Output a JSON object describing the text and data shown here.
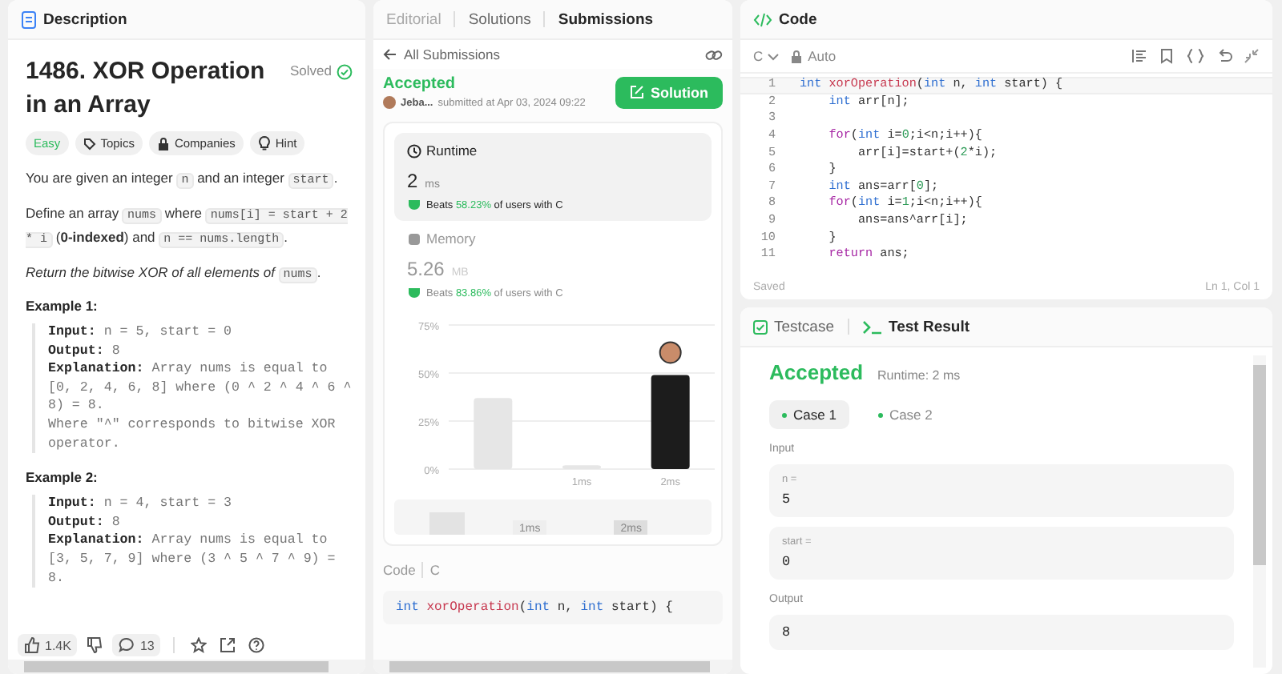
{
  "description_panel": {
    "tab": "Description",
    "title": "1486. XOR Operation in an Array",
    "status": "Solved",
    "tags": [
      {
        "kind": "difficulty",
        "label": "Easy",
        "color": "#2cbb5d"
      },
      {
        "kind": "topics",
        "label": "Topics"
      },
      {
        "kind": "companies",
        "label": "Companies"
      },
      {
        "kind": "hint",
        "label": "Hint"
      }
    ],
    "paragraphs": [
      [
        {
          "kind": "text",
          "text": "You are given an integer "
        },
        {
          "kind": "code",
          "text": "n"
        },
        {
          "kind": "text",
          "text": " and an integer "
        },
        {
          "kind": "code",
          "text": "start"
        },
        {
          "kind": "text",
          "text": "."
        }
      ],
      [
        {
          "kind": "text",
          "text": "Define an array "
        },
        {
          "kind": "code",
          "text": "nums"
        },
        {
          "kind": "text",
          "text": " where "
        },
        {
          "kind": "code",
          "text": "nums[i] = start + 2 * i"
        },
        {
          "kind": "text",
          "text": " ("
        },
        {
          "kind": "bold",
          "text": "0-indexed"
        },
        {
          "kind": "text",
          "text": ") and "
        },
        {
          "kind": "code",
          "text": "n == nums.length"
        },
        {
          "kind": "text",
          "text": "."
        }
      ],
      [
        {
          "kind": "italic",
          "text": "Return the bitwise XOR of all elements of "
        },
        {
          "kind": "code",
          "text": "nums"
        },
        {
          "kind": "text",
          "text": "."
        }
      ]
    ],
    "examples": [
      {
        "title": "Example 1:",
        "input_label": "Input:",
        "output_label": "Output:",
        "explanation_label": "Explanation:",
        "input": "n = 5, start = 0",
        "output": "8",
        "explanation": "Array nums is equal to [0, 2, 4, 6, 8] where (0 ^ 2 ^ 4 ^ 6 ^ 8) = 8.\nWhere \"^\" corresponds to bitwise XOR operator."
      },
      {
        "title": "Example 2:",
        "input_label": "Input:",
        "output_label": "Output:",
        "explanation_label": "Explanation:",
        "input": "n = 4, start = 3",
        "output": "8",
        "explanation": "Array nums is equal to [3, 5, 7, 9] where (3 ^ 5 ^ 7 ^ 9) = 8."
      }
    ],
    "footer": {
      "likes": "1.4K",
      "comments": "13"
    }
  },
  "submission_panel": {
    "tabs": [
      {
        "label": "Editorial",
        "selected": false,
        "disabled": true
      },
      {
        "label": "Solutions",
        "selected": false,
        "disabled": false
      },
      {
        "label": "Submissions",
        "selected": true,
        "disabled": false
      }
    ],
    "back": "All Submissions",
    "result": "Accepted",
    "user": "Jeba...",
    "submitted": "submitted at Apr 03, 2024 09:22",
    "solution_button": "Solution",
    "metrics": [
      {
        "kind": "runtime",
        "label": "Runtime",
        "value": "2",
        "unit": "ms",
        "beats": "Beats",
        "percent": "58.23%",
        "suffix": "of users with C",
        "selected": true
      },
      {
        "kind": "memory",
        "label": "Memory",
        "value": "5.26",
        "unit": "MB",
        "beats": "Beats",
        "percent": "83.86%",
        "suffix": "of users with C",
        "selected": false
      }
    ],
    "chart_data": {
      "type": "bar",
      "categories": [
        null,
        "1ms",
        "2ms"
      ],
      "yticks": [
        {
          "value": 0,
          "label": "0%"
        },
        {
          "value": 25,
          "label": "25%"
        },
        {
          "value": 50,
          "label": "50%"
        },
        {
          "value": 75,
          "label": "75%"
        }
      ],
      "ylim": [
        0,
        75
      ],
      "series": [
        {
          "color": "#e6e6e6",
          "values": [
            37,
            2,
            null
          ]
        },
        {
          "color": "#1c1c1c",
          "values": [
            null,
            null,
            49
          ]
        }
      ]
    },
    "overview": {
      "labels": [
        "1ms",
        "2ms"
      ]
    },
    "code_label": "Code",
    "code_lang": "C",
    "code_preview": [
      {
        "kind": "type",
        "text": "int"
      },
      {
        "kind": "function",
        "text": " xorOperation"
      },
      {
        "kind": "plain",
        "text": "("
      },
      {
        "kind": "type",
        "text": "int"
      },
      {
        "kind": "plain",
        "text": " n, "
      },
      {
        "kind": "type",
        "text": "int"
      },
      {
        "kind": "plain",
        "text": " start) {"
      }
    ]
  },
  "code_panel": {
    "title": "Code",
    "language": "C",
    "mode": "Auto",
    "lines": [
      {
        "number": "1",
        "current": true,
        "tokens": [
          {
            "kind": "type",
            "text": "int"
          },
          {
            "kind": "function",
            "text": " xorOperation"
          },
          {
            "kind": "plain",
            "text": "("
          },
          {
            "kind": "type",
            "text": "int"
          },
          {
            "kind": "plain",
            "text": " n, "
          },
          {
            "kind": "type",
            "text": "int"
          },
          {
            "kind": "plain",
            "text": " start) {"
          }
        ]
      },
      {
        "number": "2",
        "current": false,
        "tokens": [
          {
            "kind": "type",
            "text": "    int"
          },
          {
            "kind": "plain",
            "text": " arr[n];"
          }
        ]
      },
      {
        "number": "3",
        "current": false
      },
      {
        "number": "4",
        "current": false,
        "tokens": [
          {
            "kind": "control",
            "text": "    for"
          },
          {
            "kind": "plain",
            "text": "("
          },
          {
            "kind": "type",
            "text": "int"
          },
          {
            "kind": "plain",
            "text": " i="
          },
          {
            "kind": "number",
            "text": "0"
          },
          {
            "kind": "plain",
            "text": ";i<n;i++){"
          }
        ]
      },
      {
        "number": "5",
        "current": false,
        "tokens": [
          {
            "kind": "plain",
            "text": "        arr[i]=start+("
          },
          {
            "kind": "number",
            "text": "2"
          },
          {
            "kind": "plain",
            "text": "*i);"
          }
        ]
      },
      {
        "number": "6",
        "current": false,
        "tokens": [
          {
            "kind": "plain",
            "text": "    }"
          }
        ]
      },
      {
        "number": "7",
        "current": false,
        "tokens": [
          {
            "kind": "type",
            "text": "    int"
          },
          {
            "kind": "plain",
            "text": " ans=arr["
          },
          {
            "kind": "number",
            "text": "0"
          },
          {
            "kind": "plain",
            "text": "];"
          }
        ]
      },
      {
        "number": "8",
        "current": false,
        "tokens": [
          {
            "kind": "control",
            "text": "    for"
          },
          {
            "kind": "plain",
            "text": "("
          },
          {
            "kind": "type",
            "text": "int"
          },
          {
            "kind": "plain",
            "text": " i="
          },
          {
            "kind": "number",
            "text": "1"
          },
          {
            "kind": "plain",
            "text": ";i<n;i++){"
          }
        ]
      },
      {
        "number": "9",
        "current": false,
        "tokens": [
          {
            "kind": "plain",
            "text": "        ans=ans^arr[i];"
          }
        ]
      },
      {
        "number": "10",
        "current": false,
        "tokens": [
          {
            "kind": "plain",
            "text": "    }"
          }
        ]
      },
      {
        "number": "11",
        "current": false,
        "tokens": [
          {
            "kind": "control",
            "text": "    return"
          },
          {
            "kind": "plain",
            "text": " ans;"
          }
        ]
      }
    ],
    "saved": "Saved",
    "cursor": "Ln 1, Col 1"
  },
  "test_panel": {
    "tabs": [
      {
        "label": "Testcase",
        "selected": false
      },
      {
        "label": "Test Result",
        "selected": true
      }
    ],
    "result": "Accepted",
    "runtime": "Runtime: 2 ms",
    "cases": [
      {
        "label": "Case 1",
        "selected": true
      },
      {
        "label": "Case 2",
        "selected": false
      }
    ],
    "input_label": "Input",
    "inputs": [
      {
        "name": "n =",
        "value": "5"
      },
      {
        "name": "start =",
        "value": "0"
      }
    ],
    "output_label": "Output",
    "output": "8"
  }
}
